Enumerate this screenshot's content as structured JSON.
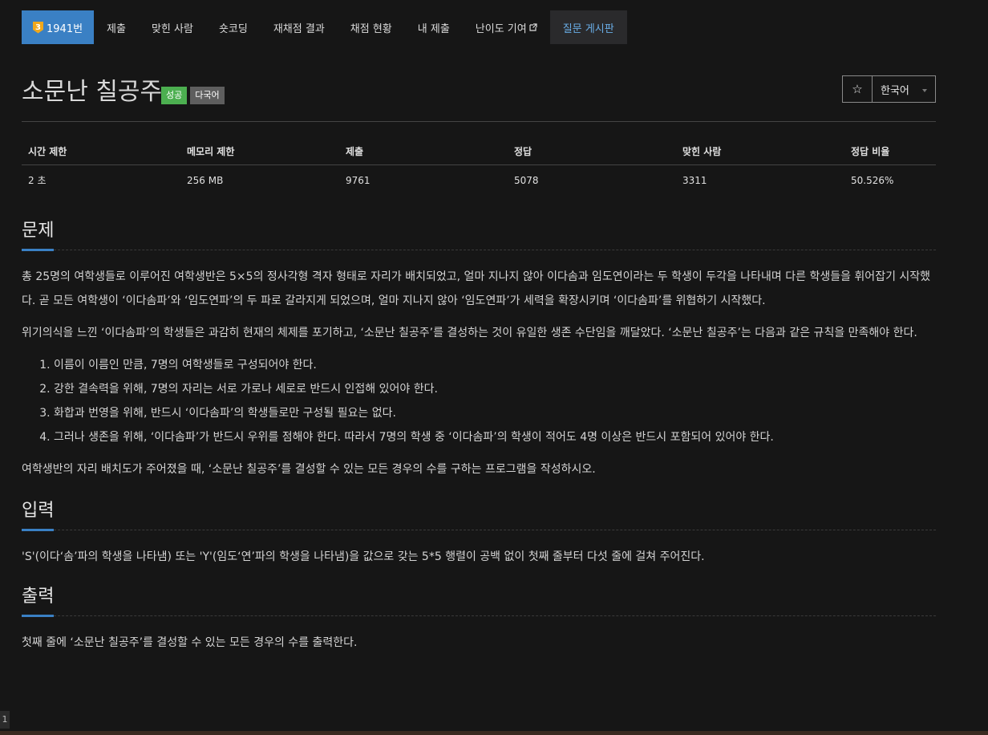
{
  "nav": {
    "problem_tier": "3",
    "problem_id": "1941번",
    "items": [
      "제출",
      "맞힌 사람",
      "숏코딩",
      "재채점 결과",
      "채점 현황",
      "내 제출",
      "난이도 기여",
      "질문 게시판"
    ]
  },
  "problem": {
    "title": "소문난 칠공주",
    "badge_success": "성공",
    "badge_multilang": "다국어",
    "star": "☆",
    "language": "한국어"
  },
  "stats": {
    "headers": [
      "시간 제한",
      "메모리 제한",
      "제출",
      "정답",
      "맞힌 사람",
      "정답 비율"
    ],
    "values": [
      "2 초",
      "256 MB",
      "9761",
      "5078",
      "3311",
      "50.526%"
    ]
  },
  "sections": {
    "description_title": "문제",
    "description_p1": "총 25명의 여학생들로 이루어진 여학생반은 5×5의 정사각형 격자 형태로 자리가 배치되었고, 얼마 지나지 않아 이다솜과 임도연이라는 두 학생이 두각을 나타내며 다른 학생들을 휘어잡기 시작했다. 곧 모든 여학생이 ‘이다솜파’와 ‘임도연파’의 두 파로 갈라지게 되었으며, 얼마 지나지 않아 ‘임도연파’가 세력을 확장시키며 ‘이다솜파’를 위협하기 시작했다.",
    "description_p2": "위기의식을 느낀 ‘이다솜파’의 학생들은 과감히 현재의 체제를 포기하고, ‘소문난 칠공주’를 결성하는 것이 유일한 생존 수단임을 깨달았다. ‘소문난 칠공주’는 다음과 같은 규칙을 만족해야 한다.",
    "rules": [
      "이름이 이름인 만큼, 7명의 여학생들로 구성되어야 한다.",
      "강한 결속력을 위해, 7명의 자리는 서로 가로나 세로로 반드시 인접해 있어야 한다.",
      "화합과 번영을 위해, 반드시 ‘이다솜파’의 학생들로만 구성될 필요는 없다.",
      "그러나 생존을 위해, ‘이다솜파’가 반드시 우위를 점해야 한다. 따라서 7명의 학생 중 ‘이다솜파’의 학생이 적어도 4명 이상은 반드시 포함되어 있어야 한다."
    ],
    "description_p3": "여학생반의 자리 배치도가 주어졌을 때, ‘소문난 칠공주’를 결성할 수 있는 모든 경우의 수를 구하는 프로그램을 작성하시오.",
    "input_title": "입력",
    "input_text": "'S'(이다‘솜’파의 학생을 나타냄) 또는 'Y'(임도‘연’파의 학생을 나타냄)을 값으로 갖는 5*5 행렬이 공백 없이 첫째 줄부터 다섯 줄에 걸쳐 주어진다.",
    "output_title": "출력",
    "output_text": "첫째 줄에 ‘소문난 칠공주’를 결성할 수 있는 모든 경우의 수를 출력한다."
  },
  "gutter_number": "1",
  "colors": {
    "accent": "#3a80c4",
    "success": "#4caf50",
    "tier_gold": "#f0a81c",
    "background": "#161616"
  }
}
